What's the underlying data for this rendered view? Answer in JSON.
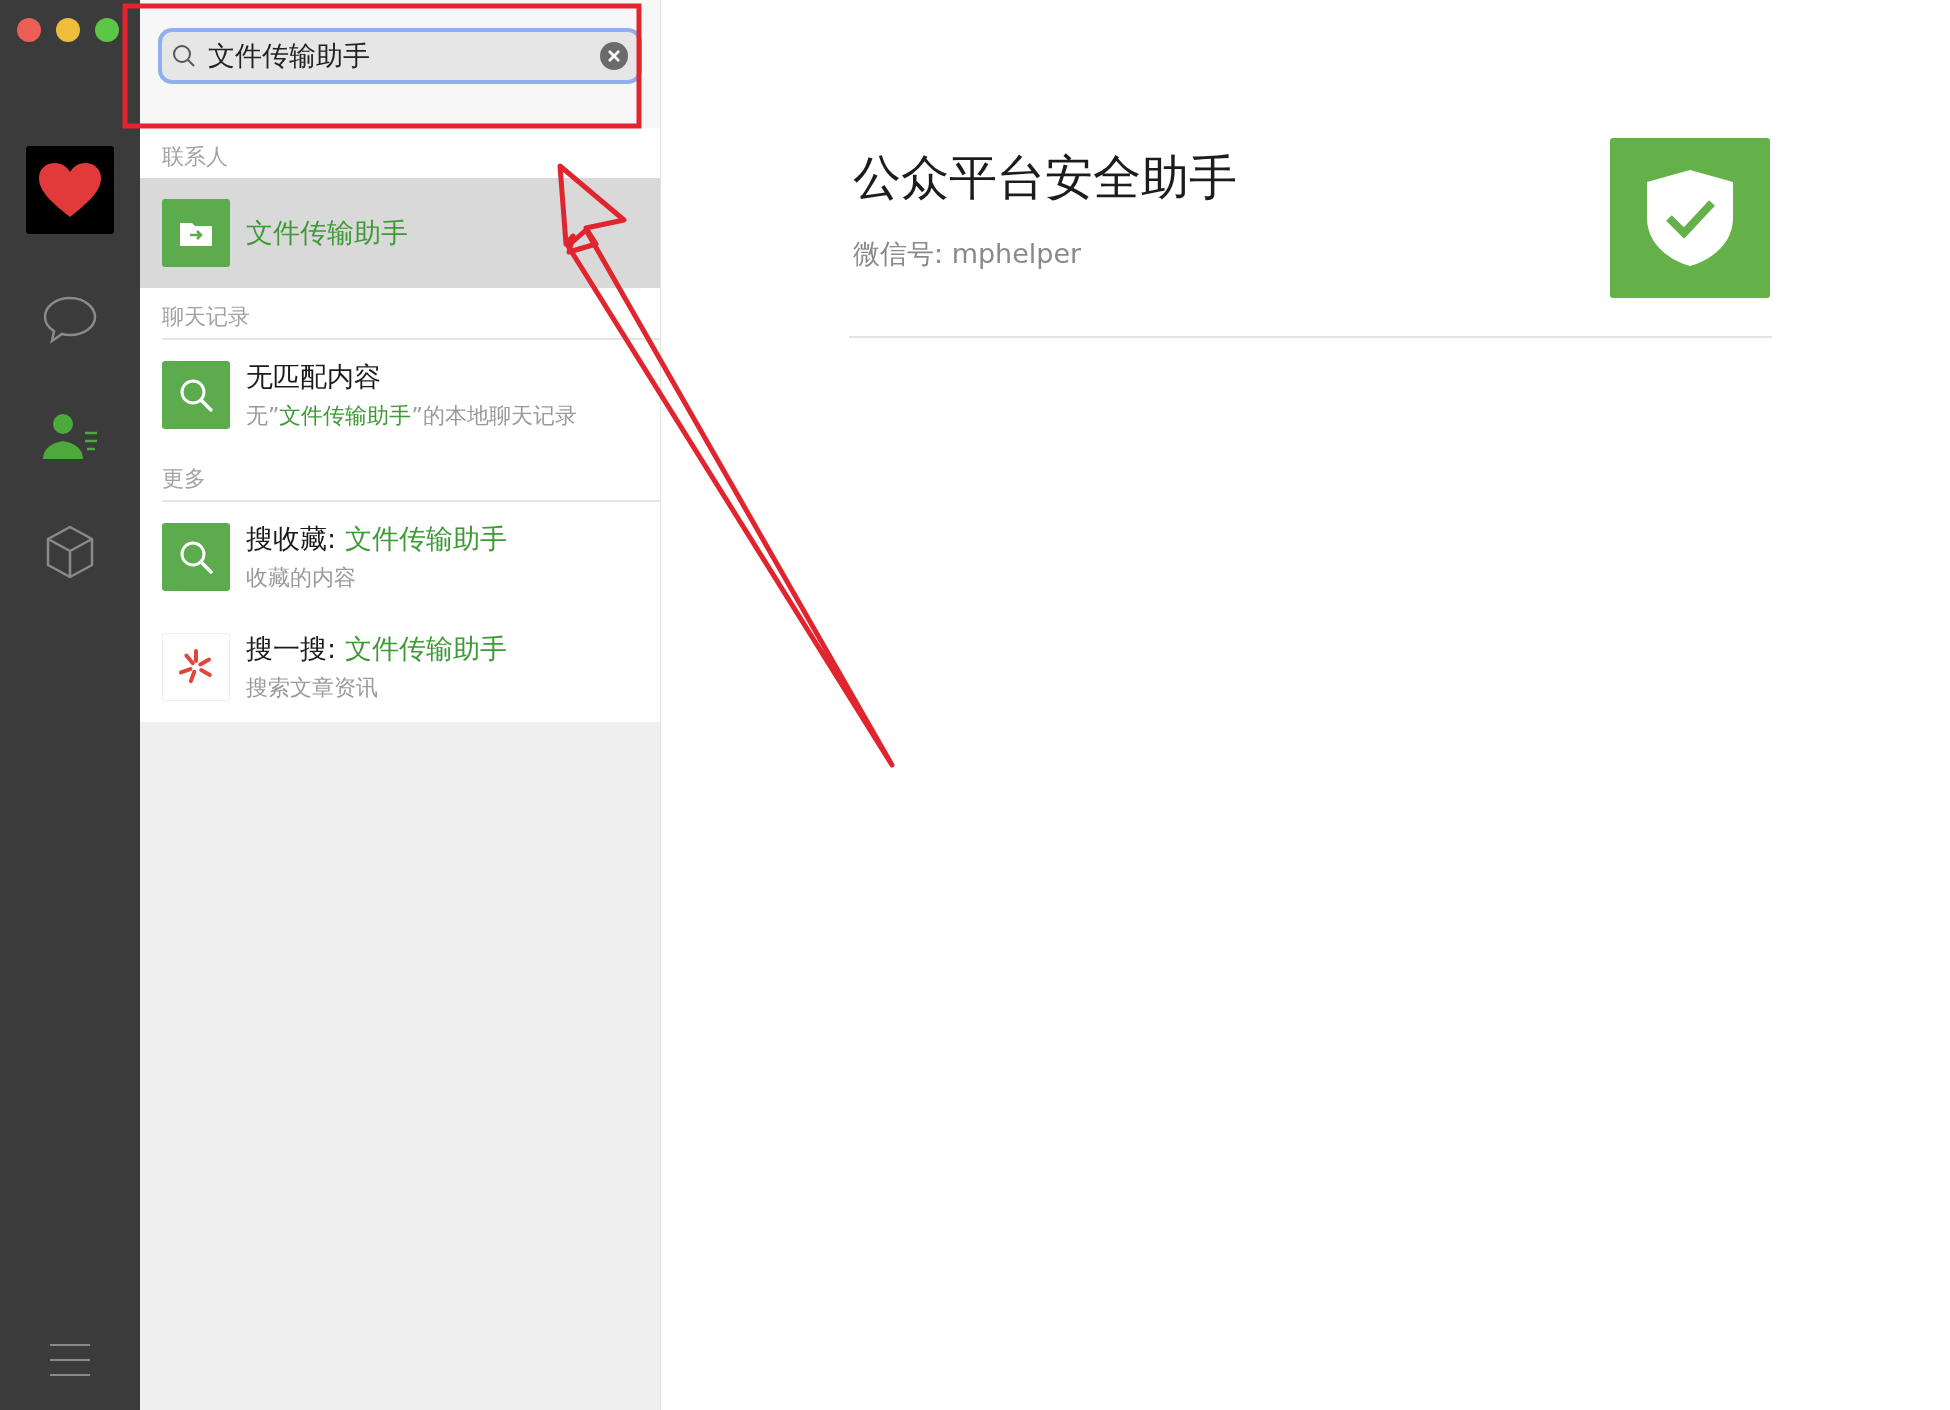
{
  "sidebar": {
    "nav": [
      {
        "kind": "chat",
        "selected": false
      },
      {
        "kind": "contacts",
        "selected": true
      },
      {
        "kind": "favorites",
        "selected": false
      }
    ]
  },
  "search": {
    "value": "文件传输助手"
  },
  "sections": [
    {
      "title": "联系人",
      "items": [
        {
          "kind": "contact",
          "title": "文件传输助手",
          "selected": true
        }
      ]
    },
    {
      "title": "聊天记录",
      "items": [
        {
          "kind": "search",
          "title": "无匹配内容",
          "subtitle": {
            "before": "无”",
            "highlight": "文件传输助手",
            "after": "”的本地聊天记录"
          },
          "selected": false
        }
      ]
    },
    {
      "title": "更多",
      "items": [
        {
          "kind": "search",
          "title": "搜收藏: ",
          "highlight": "文件传输助手",
          "subtitle": {
            "before": "收藏的内容"
          },
          "selected": false
        },
        {
          "kind": "sousou",
          "title": "搜一搜: ",
          "highlight": "文件传输助手",
          "subtitle": {
            "before": "搜索文章资讯"
          },
          "selected": false
        }
      ]
    }
  ],
  "detail": {
    "title": "公众平台安全助手",
    "wechat_id": "微信号: mphelper"
  }
}
